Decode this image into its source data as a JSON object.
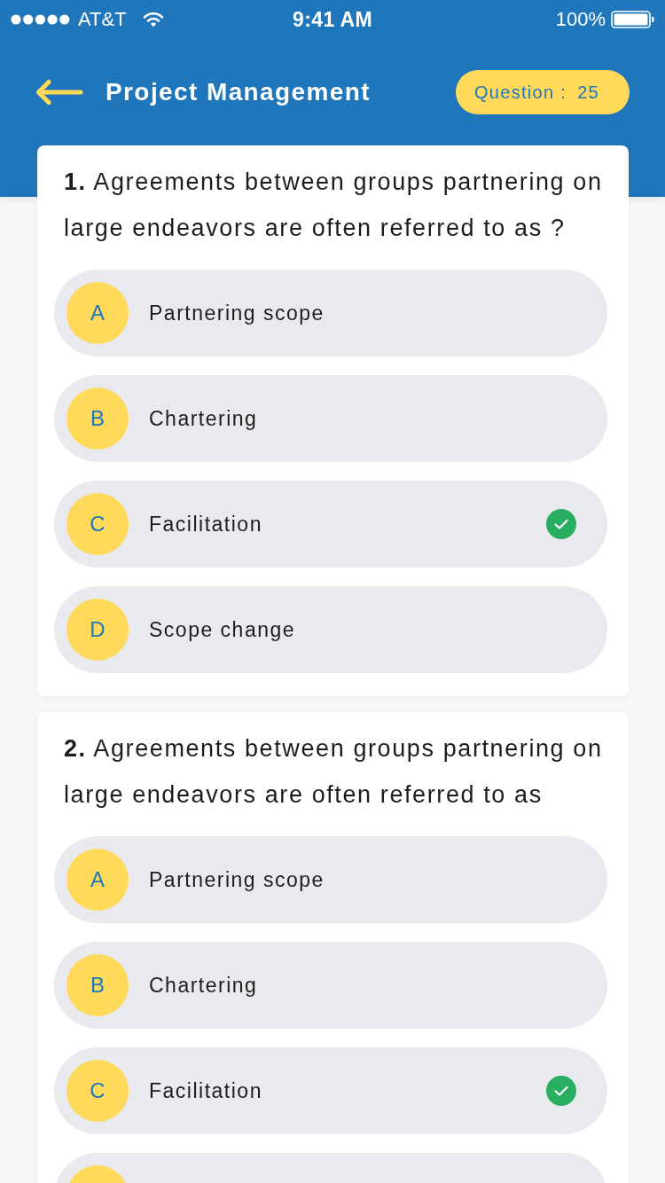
{
  "status_bar": {
    "carrier": "AT&T",
    "time": "9:41 AM",
    "battery": "100%"
  },
  "header": {
    "title": "Project Management",
    "question_counter": {
      "label": "Question :",
      "value": "25"
    }
  },
  "questions": [
    {
      "text": "**1.** Agreements between groups partnering on large endeavors are often referred to as ?",
      "options": [
        {
          "letter": "A",
          "label": "Partnering scope",
          "correct": false
        },
        {
          "letter": "B",
          "label": "Chartering",
          "correct": false
        },
        {
          "letter": "C",
          "label": "Facilitation",
          "correct": true
        },
        {
          "letter": "D",
          "label": "Scope change",
          "correct": false
        }
      ]
    },
    {
      "text": "**2.** Agreements between groups partnering on large endeavors are often referred to as",
      "options": [
        {
          "letter": "A",
          "label": "Partnering scope",
          "correct": false
        },
        {
          "letter": "B",
          "label": "Chartering",
          "correct": false
        },
        {
          "letter": "C",
          "label": "Facilitation",
          "correct": true
        },
        {
          "correct": false
        }
      ]
    }
  ]
}
